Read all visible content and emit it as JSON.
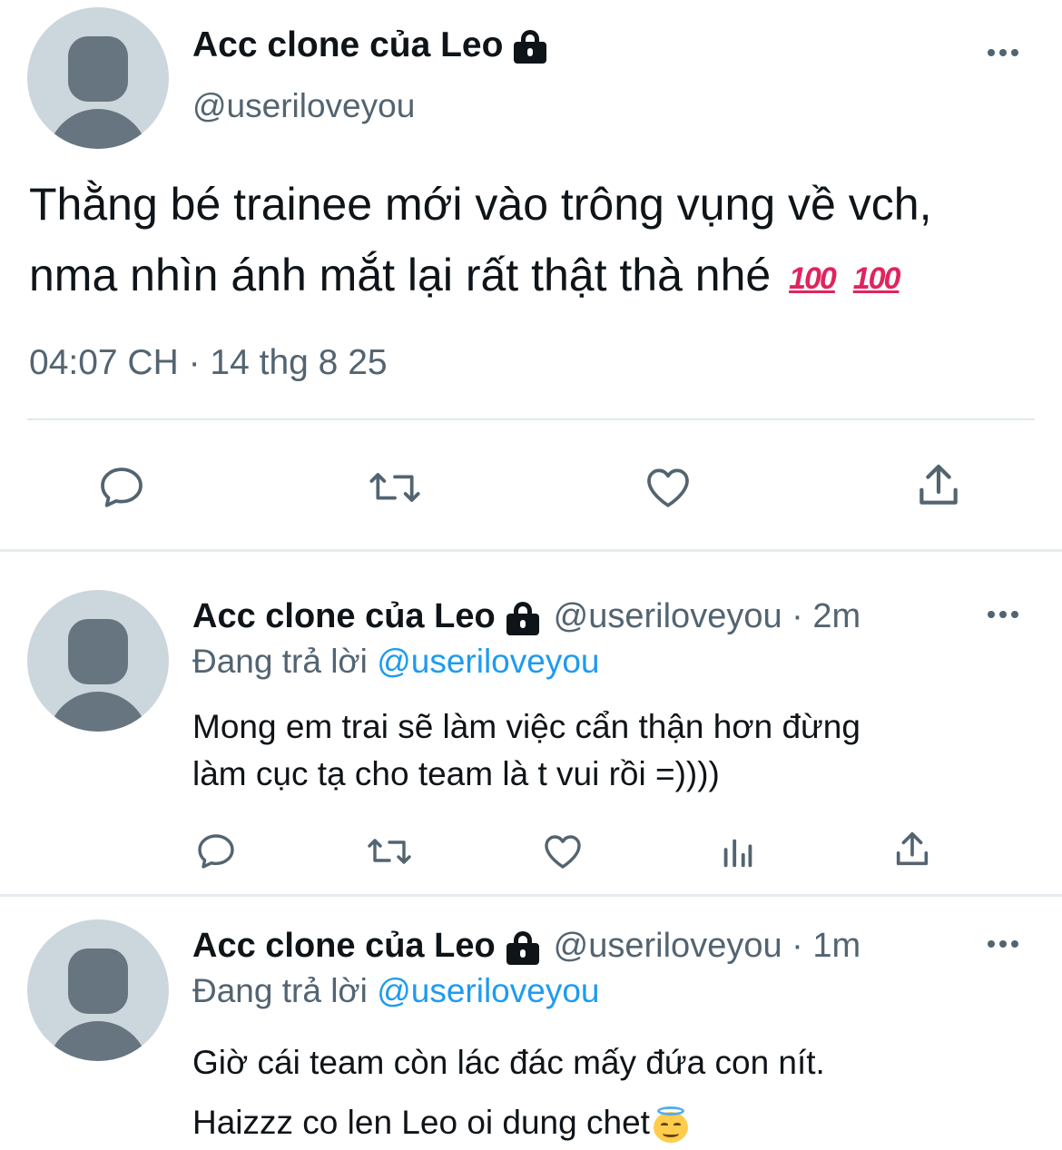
{
  "main_tweet": {
    "display_name": "Acc clone của Leo",
    "handle": "@useriloveyou",
    "text_line1": "Thằng bé trainee mới vào trông vụng về vch,",
    "text_line2": "nma nhìn ánh mắt lại rất thật thà nhé",
    "emoji": "💯",
    "timestamp": "04:07 CH · 14 thg 8 25",
    "actions": [
      "reply-icon",
      "retweet-icon",
      "like-icon",
      "share-icon"
    ]
  },
  "replies": [
    {
      "display_name": "Acc clone của Leo",
      "meta": "@useriloveyou · 2m",
      "replying_prefix": "Đang trả lời",
      "replying_to": "@useriloveyou",
      "text_line1": "Mong em trai sẽ làm việc cẩn thận hơn đừng",
      "text_line2": "làm cục tạ cho team là t vui rồi =))))",
      "actions": [
        "reply-icon",
        "retweet-icon",
        "like-icon",
        "views-icon",
        "share-icon"
      ]
    },
    {
      "display_name": "Acc clone của Leo",
      "meta": "@useriloveyou · 1m",
      "replying_prefix": "Đang trả lời",
      "replying_to": "@useriloveyou",
      "text_line1": "Giờ cái team còn lác đác mấy đứa con nít.",
      "text_line2": "Haizzz co len Leo oi dung chet",
      "emoji": "😇"
    }
  ],
  "colors": {
    "text": "#0f1419",
    "secondary": "#536471",
    "link": "#1d9bf0",
    "avatar_bg": "#ccd6dd",
    "avatar_fg": "#66757f"
  }
}
